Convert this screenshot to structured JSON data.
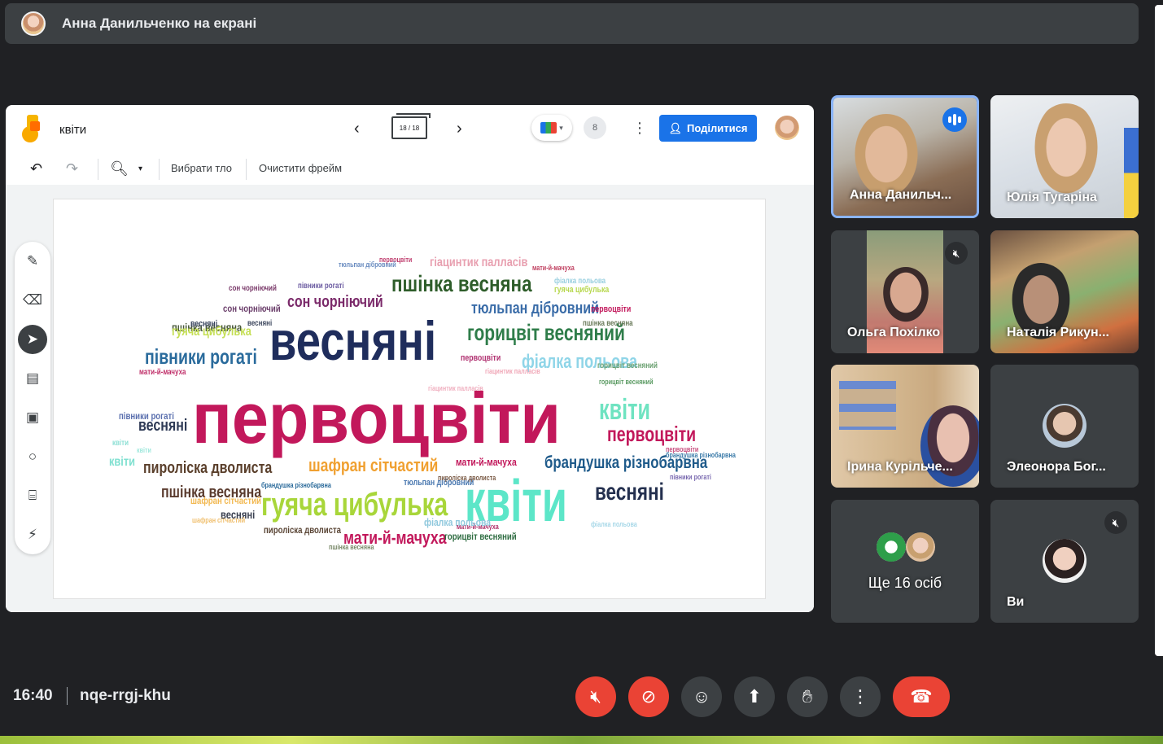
{
  "presenting_bar": {
    "text": "Анна Данильченко на екрані"
  },
  "jamboard": {
    "title": "квіти",
    "frame_counter": "18 / 18",
    "participants_count": "8",
    "share_label": "Поділитися",
    "toolbar": {
      "set_background": "Вибрати тло",
      "clear_frame": "Очистити фрейм"
    }
  },
  "word_cloud": [
    {
      "t": "первоцвіти",
      "c": "#c2185b"
    },
    {
      "t": "весняні",
      "c": "#1f2d5c"
    },
    {
      "t": "квіти",
      "c": "#5ce6c8"
    },
    {
      "t": "пшінка весняна",
      "c": "#2e5d2a"
    },
    {
      "t": "горицвіт весняний",
      "c": "#2f7d4a"
    },
    {
      "t": "півники рогаті",
      "c": "#2a6b9c"
    },
    {
      "t": "гуяча цибулька",
      "c": "#a8d63a"
    },
    {
      "t": "квіти",
      "c": "#6fe3c1"
    },
    {
      "t": "первоцвіти",
      "c": "#c2185b"
    },
    {
      "t": "весняні",
      "c": "#24304f"
    },
    {
      "t": "пшінка весняна",
      "c": "#5a3b2e"
    },
    {
      "t": "шафран сітчастий",
      "c": "#f0a030"
    },
    {
      "t": "пироліска дволиста",
      "c": "#5a3f2b"
    },
    {
      "t": "брандушка різнобарвна",
      "c": "#1e5a8a"
    },
    {
      "t": "мати-й-мачуха",
      "c": "#c2185b"
    },
    {
      "t": "тюльпан дібровний",
      "c": "#3a6ca8"
    },
    {
      "t": "сон чорніючий",
      "c": "#7b2a6a"
    },
    {
      "t": "фіалка польова",
      "c": "#8fd5e8"
    },
    {
      "t": "гіацинтик палласів",
      "c": "#e8a0b0"
    },
    {
      "t": "первоцвіти",
      "c": "#c2185b"
    },
    {
      "t": "весняні",
      "c": "#2e3a55"
    },
    {
      "t": "мати-й-мачуха",
      "c": "#c2185b"
    },
    {
      "t": "квіти",
      "c": "#7fe0d0"
    },
    {
      "t": "пшінка весняна",
      "c": "#4a5a3a"
    },
    {
      "t": "весняні",
      "c": "#3a4050"
    },
    {
      "t": "пироліска дволиста",
      "c": "#5a4535"
    },
    {
      "t": "горицвіт весняний",
      "c": "#2f6d42"
    },
    {
      "t": "мати-й-мачуха",
      "c": "#b0306a"
    },
    {
      "t": "фіалка польова",
      "c": "#8fc8dd"
    },
    {
      "t": "гуяча цибулька",
      "c": "#c5df55"
    },
    {
      "t": "сон чорніючий",
      "c": "#6a3d6a"
    },
    {
      "t": "первоцвіти",
      "c": "#b03070"
    },
    {
      "t": "півники рогаті",
      "c": "#5a6fae"
    },
    {
      "t": "шафран сітчастий",
      "c": "#f2b850"
    },
    {
      "t": "весняні",
      "c": "#34405a"
    },
    {
      "t": "тюльпан дібровний",
      "c": "#4a78b0"
    },
    {
      "t": "мати-й-мачуха",
      "c": "#c0306a"
    },
    {
      "t": "горицвіт весняний",
      "c": "#5a9a62"
    },
    {
      "t": "брандушка різнобарвна",
      "c": "#2a6a9a"
    },
    {
      "t": "гіацинтик палласів",
      "c": "#f0a8b8"
    },
    {
      "t": "півники рогаті",
      "c": "#6a5aa0"
    },
    {
      "t": "пшінка весняна",
      "c": "#6a7a5a"
    },
    {
      "t": "фіалка польова",
      "c": "#9ad0e0"
    },
    {
      "t": "сон чорніючий",
      "c": "#7a3a6a"
    },
    {
      "t": "весняні",
      "c": "#404a60"
    },
    {
      "t": "гуяча цибулька",
      "c": "#b8d850"
    },
    {
      "t": "шафран сітчастий",
      "c": "#f0c070"
    },
    {
      "t": "первоцвіти",
      "c": "#c04070"
    },
    {
      "t": "мати-й-мачуха",
      "c": "#c04060"
    },
    {
      "t": "квіти",
      "c": "#8ee0d5"
    },
    {
      "t": "тюльпан дібровний",
      "c": "#6a8cc0"
    },
    {
      "t": "горицвіт весняний",
      "c": "#6aa070"
    },
    {
      "t": "пироліска дволиста",
      "c": "#7a5a45"
    },
    {
      "t": "гіацинтик палласів",
      "c": "#f0b0c0"
    },
    {
      "t": "брандушка різнобарвна",
      "c": "#3a7aa8"
    },
    {
      "t": "півники рогаті",
      "c": "#7a6ab0"
    },
    {
      "t": "пшінка весняна",
      "c": "#7a8a6a"
    },
    {
      "t": "квіти",
      "c": "#a0e8dd"
    },
    {
      "t": "первоцвіти",
      "c": "#c85080"
    },
    {
      "t": "фіалка польова",
      "c": "#a8d8e8"
    }
  ],
  "participants": [
    {
      "name": "Анна Данильч...",
      "speaking": true,
      "muted": false
    },
    {
      "name": "Юлія Тугаріна",
      "speaking": false,
      "muted": false
    },
    {
      "name": "Ольга Похілко",
      "speaking": false,
      "muted": true
    },
    {
      "name": "Наталія Рикун...",
      "speaking": false,
      "muted": false
    },
    {
      "name": "Ірина Курільче...",
      "speaking": false,
      "muted": false
    },
    {
      "name": "Элеонора Бог...",
      "speaking": false,
      "muted": false
    },
    {
      "name": "Ще 16 осіб",
      "speaking": false,
      "muted": false
    },
    {
      "name": "Ви",
      "speaking": false,
      "muted": true
    }
  ],
  "bottom_bar": {
    "time": "16:40",
    "meeting_code": "nqe-rrgj-khu"
  },
  "icons": {
    "mic_off": "mic-off-icon",
    "cam_off": "videocam-off-icon",
    "emoji": "emoji-icon",
    "present": "present-screen-icon",
    "raise_hand": "raise-hand-icon",
    "more": "more-vert-icon",
    "hangup": "call-end-icon"
  },
  "colors": {
    "accent": "#1a73e8",
    "danger": "#ea4335",
    "tile_bg": "#3c4043",
    "bg": "#202124"
  }
}
